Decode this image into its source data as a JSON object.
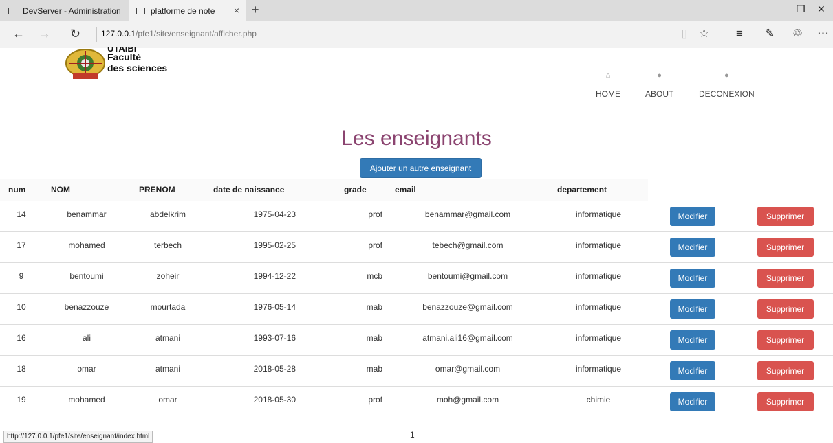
{
  "browser": {
    "tabs": [
      {
        "label": "DevServer - Administration"
      },
      {
        "label": "platforme de note"
      }
    ],
    "tab_close_glyph": "×",
    "tab_new_glyph": "+",
    "url_host": "127.0.0.1",
    "url_path": "/pfe1/site/enseignant/afficher.php",
    "status_url": "http://127.0.0.1/pfe1/site/enseignant/index.html"
  },
  "brand": {
    "line1": "Faculté",
    "line2": "des sciences",
    "cut_text": "UTAIBI"
  },
  "nav": {
    "home": "HOME",
    "about": "ABOUT",
    "logout": "DECONEXION"
  },
  "page": {
    "title": "Les enseignants",
    "add_button": "Ajouter un autre enseignant",
    "pagination": "1"
  },
  "table": {
    "headers": [
      "num",
      "NOM",
      "PRENOM",
      "date de naissance",
      "grade",
      "email",
      "departement"
    ],
    "edit_label": "Modifier",
    "delete_label": "Supprimer",
    "rows": [
      [
        "14",
        "benammar",
        "abdelkrim",
        "1975-04-23",
        "prof",
        "benammar@gmail.com",
        "informatique"
      ],
      [
        "17",
        "mohamed",
        "terbech",
        "1995-02-25",
        "prof",
        "tebech@gmail.com",
        "informatique"
      ],
      [
        "9",
        "bentoumi",
        "zoheir",
        "1994-12-22",
        "mcb",
        "bentoumi@gmail.com",
        "informatique"
      ],
      [
        "10",
        "benazzouze",
        "mourtada",
        "1976-05-14",
        "mab",
        "benazzouze@gmail.com",
        "informatique"
      ],
      [
        "16",
        "ali",
        "atmani",
        "1993-07-16",
        "mab",
        "atmani.ali16@gmail.com",
        "informatique"
      ],
      [
        "18",
        "omar",
        "atmani",
        "2018-05-28",
        "mab",
        "omar@gmail.com",
        "informatique"
      ],
      [
        "19",
        "mohamed",
        "omar",
        "2018-05-30",
        "prof",
        "moh@gmail.com",
        "chimie"
      ]
    ]
  },
  "colors": {
    "title": "#8b4470",
    "primary": "#337ab7",
    "danger": "#d9534f"
  },
  "icons": {
    "home": "home-icon",
    "about": "user-icon",
    "logout": "user-icon"
  }
}
